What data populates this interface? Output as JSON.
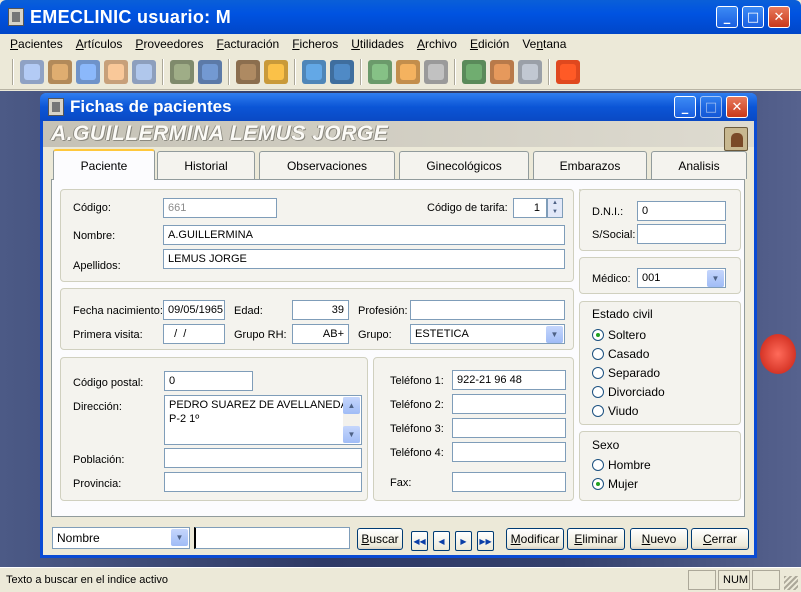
{
  "app": {
    "title": "EMECLINIC usuario: M"
  },
  "menu": [
    {
      "pre": "",
      "u": "P",
      "post": "acientes"
    },
    {
      "pre": "",
      "u": "A",
      "post": "rtículos"
    },
    {
      "pre": "",
      "u": "P",
      "post": "roveedores"
    },
    {
      "pre": "",
      "u": "F",
      "post": "acturación"
    },
    {
      "pre": "",
      "u": "F",
      "post": "icheros"
    },
    {
      "pre": "",
      "u": "U",
      "post": "tilidades"
    },
    {
      "pre": "",
      "u": "A",
      "post": "rchivo"
    },
    {
      "pre": "",
      "u": "E",
      "post": "dición"
    },
    {
      "pre": "Ve",
      "u": "n",
      "post": "tana"
    }
  ],
  "child": {
    "title": "Fichas de pacientes",
    "patient_name": "A.GUILLERMINA LEMUS JORGE"
  },
  "tabs": [
    "Paciente",
    "Historial",
    "Observaciones",
    "Ginecológicos",
    "Embarazos",
    "Analisis"
  ],
  "identity": {
    "codigo_label": "Código:",
    "codigo": "661",
    "tarifa_label": "Código de tarifa:",
    "tarifa": "1",
    "nombre_label": "Nombre:",
    "nombre": "A.GUILLERMINA",
    "apellidos_label": "Apellidos:",
    "apellidos": "LEMUS JORGE"
  },
  "dni": {
    "dni_label": "D.N.I.:",
    "dni": "0",
    "ssocial_label": "S/Social:",
    "ssocial": ""
  },
  "medico": {
    "label": "Médico:",
    "value": "001"
  },
  "details": {
    "nac_label": "Fecha nacimiento:",
    "nac": "09/05/1965",
    "edad_label": "Edad:",
    "edad": "39",
    "profesion_label": "Profesión:",
    "profesion": "",
    "visita_label": "Primera visita:",
    "visita": "  /  /",
    "rh_label": "Grupo RH:",
    "rh": "AB+",
    "grupo_label": "Grupo:",
    "grupo": "ESTETICA"
  },
  "estado_civil": {
    "title": "Estado civil",
    "options": [
      "Soltero",
      "Casado",
      "Separado",
      "Divorciado",
      "Viudo"
    ],
    "selected": 0
  },
  "address": {
    "cp_label": "Código postal:",
    "cp": "0",
    "dir_label": "Dirección:",
    "dir_line1": "PEDRO SUAREZ DE AVELLANEDA",
    "dir_line2": "P-2 1º",
    "poblacion_label": "Población:",
    "poblacion": "",
    "provincia_label": "Provincia:",
    "provincia": ""
  },
  "phones": {
    "t1_label": "Teléfono 1:",
    "t1": "922-21 96 48",
    "t2_label": "Teléfono 2:",
    "t2": "",
    "t3_label": "Teléfono 3:",
    "t3": "",
    "t4_label": "Teléfono 4:",
    "t4": "",
    "fax_label": "Fax:",
    "fax": ""
  },
  "sexo": {
    "title": "Sexo",
    "options": [
      "Hombre",
      "Mujer"
    ],
    "selected": 1
  },
  "bottom": {
    "search_field": "Nombre",
    "search_text": "",
    "buscar": {
      "u": "B",
      "post": "uscar"
    },
    "modificar": {
      "u": "M",
      "post": "odificar"
    },
    "eliminar": {
      "u": "E",
      "post": "liminar"
    },
    "nuevo": {
      "u": "N",
      "post": "uevo"
    },
    "cerrar": {
      "u": "C",
      "post": "errar"
    }
  },
  "status": {
    "text": "Texto a buscar en el indice activo",
    "num": "NUM"
  },
  "colors": {
    "titlebar": "#0053e1",
    "mdi": "#34406c",
    "window": "#ece9d8"
  }
}
